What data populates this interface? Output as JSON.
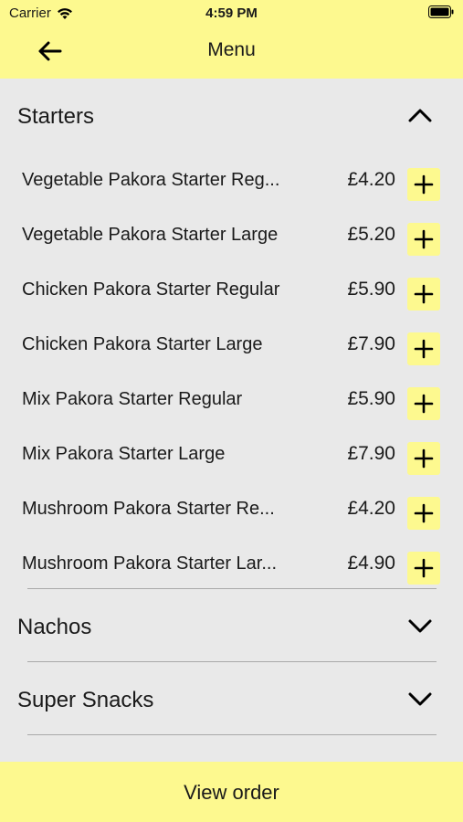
{
  "status_bar": {
    "carrier": "Carrier",
    "time": "4:59 PM"
  },
  "header": {
    "title": "Menu"
  },
  "sections": [
    {
      "title": "Starters",
      "expanded": true,
      "items": [
        {
          "name": "Vegetable Pakora Starter Reg...",
          "price": "£4.20"
        },
        {
          "name": "Vegetable Pakora Starter Large",
          "price": "£5.20"
        },
        {
          "name": "Chicken Pakora Starter Regular",
          "price": "£5.90"
        },
        {
          "name": "Chicken Pakora Starter Large",
          "price": "£7.90"
        },
        {
          "name": "Mix Pakora Starter Regular",
          "price": "£5.90"
        },
        {
          "name": "Mix Pakora Starter Large",
          "price": "£7.90"
        },
        {
          "name": "Mushroom Pakora Starter Re...",
          "price": "£4.20"
        },
        {
          "name": "Mushroom Pakora Starter Lar...",
          "price": "£4.90"
        }
      ]
    },
    {
      "title": "Nachos",
      "expanded": false
    },
    {
      "title": "Super Snacks",
      "expanded": false
    }
  ],
  "footer": {
    "label": "View order"
  },
  "colors": {
    "accent": "#fdf98f",
    "background": "#e9e9e9",
    "divider": "#a9a9a9"
  }
}
